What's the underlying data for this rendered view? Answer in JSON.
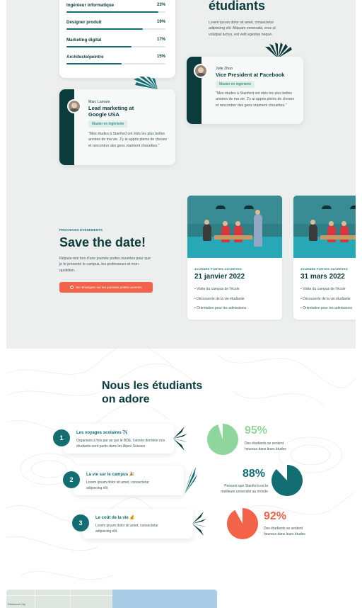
{
  "stats": [
    {
      "label": "Ingénieur informatique",
      "pct": "23%",
      "fill": 0.93
    },
    {
      "label": "Designer produit",
      "pct": "19%",
      "fill": 0.77
    },
    {
      "label": "Marketing digital",
      "pct": "17%",
      "fill": 0.66
    },
    {
      "label": "Architecte/peintre",
      "pct": "15%",
      "fill": 0.56
    }
  ],
  "hero": {
    "title": "étudiants",
    "text": "Lorem ipsum dolor sit amet, consectetur adipiscing elit. Aliquam venenatis, eros ut volutpat luctus, est velit egestas neque."
  },
  "testimonials": [
    {
      "name": "Julie Zhuo",
      "role": "Vice President at Facebook",
      "badge": "Master en ingénierie",
      "quote": "\"Mes études à Stanford ont étés les plus belles années de ma vie. J'y ai appris pleins de choses et rencontrer des gens vraiment chouettes.\""
    },
    {
      "name": "Marc Lamare",
      "role": "Lead marketing at Google USA",
      "badge": "Master en ingénierie",
      "quote": "\"Mes études à Stanford ont étés les plus belles années de ma vie. J'y ai appris pleins de choses et rencontrer des gens vraiment chouettes.\""
    }
  ],
  "events": {
    "eyebrow": "PROCHAINS ÉVÈNEMENTS",
    "title": "Save the date!",
    "description": "Réjouis-moi lors d'une journée portes ouvertes pour que je te présente le campus, les professeurs et mon quotidien.",
    "cta": "Se renseigner sur les journées portes ouvertes",
    "cards": [
      {
        "caption": "JOURNÉE PORTES OUVERTES",
        "date": "21 janvier 2022",
        "items": [
          "Visite du campus de l'école",
          "Découverte de la vie étudiante",
          "Orientation pour les admissions"
        ]
      },
      {
        "caption": "JOURNÉE PORTES OUVERTES",
        "date": "31 mars 2022",
        "items": [
          "Visite du campus de l'école",
          "Découverte de la vie étudiante",
          "Orientation pour les admissions"
        ]
      }
    ]
  },
  "adore": {
    "title_line1": "Nous les étudiants",
    "title_line2": "on adore",
    "features": [
      {
        "num": "1",
        "title": "Les voyages scolaires ✈️",
        "desc": "Organisés à fois par an par le BDE, l'année dernière nos étudiants sont partis dans les Alpes Suisses"
      },
      {
        "num": "2",
        "title": "La vie sur le campus 🎉",
        "desc": "Lorem ipsum dolor sit amet, consectetur adipiscing elit."
      },
      {
        "num": "3",
        "title": "Le coût de la vie 💰",
        "desc": "Lorem ipsum dolor sit amet, consectetur adipiscing elit."
      }
    ],
    "stats": [
      {
        "pct": "95%",
        "value": 95,
        "color": "#8fd69c",
        "desc": "Des étudiants se sentent heureux dans leurs études"
      },
      {
        "pct": "88%",
        "value": 88,
        "color": "#126e72",
        "desc": "Pensent que Stanford est la meilleure université au monde"
      },
      {
        "pct": "92%",
        "value": 92,
        "color": "#f2634a",
        "desc": "Des étudiants se sentent heureux dans leurs études"
      }
    ]
  },
  "map": {
    "label": "Redwood City"
  },
  "colors": {
    "dark": "#0b3b3b",
    "teal": "#126e72",
    "coral": "#f2634a",
    "green": "#8fd69c"
  }
}
